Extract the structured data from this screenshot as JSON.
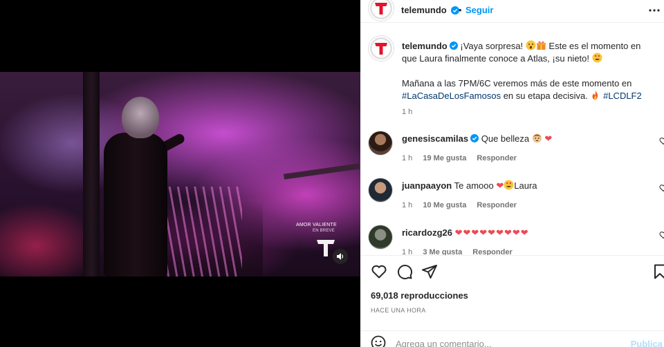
{
  "media": {
    "watermark_title": "AMOR VALIENTE",
    "watermark_sub": "EN BREVE"
  },
  "header": {
    "username": "telemundo",
    "follow_label": "Seguir"
  },
  "caption": {
    "username": "telemundo",
    "text_1": "¡Vaya sorpresa!",
    "text_2": "Este es el momento en que Laura finalmente conoce a Atlas, ¡su nieto!",
    "text_3": "Mañana a las 7PM/6C veremos más de este momento en",
    "hashtag_1": "#LaCasaDeLosFamosos",
    "text_4": "en su etapa decisiva.",
    "hashtag_2": "#LCDLF2",
    "time": "1 h"
  },
  "comments": [
    {
      "username": "genesiscamilas",
      "text": "Que belleza",
      "time": "1 h",
      "likes": "19 Me gusta",
      "reply": "Responder"
    },
    {
      "username": "juanpaayon",
      "text": "Te amooo",
      "text_2": "Laura",
      "time": "1 h",
      "likes": "10 Me gusta",
      "reply": "Responder"
    },
    {
      "username": "ricardozg26",
      "text": "",
      "time": "1 h",
      "likes": "3 Me gusta",
      "reply": "Responder"
    }
  ],
  "actions": {
    "views": "69,018 reproducciones",
    "time_ago": "HACE UNA HORA",
    "comment_placeholder": "Agrega un comentario...",
    "post_label": "Publica"
  },
  "colors": {
    "link": "#00376b",
    "accent": "#0095f6",
    "brand_red": "#e4142b",
    "heart": "#ed4956"
  },
  "icons": [
    "telemundo-logo",
    "verified-badge",
    "more-icon",
    "heart-icon",
    "comment-icon",
    "share-icon",
    "bookmark-icon",
    "emoji-icon",
    "mute-icon"
  ]
}
